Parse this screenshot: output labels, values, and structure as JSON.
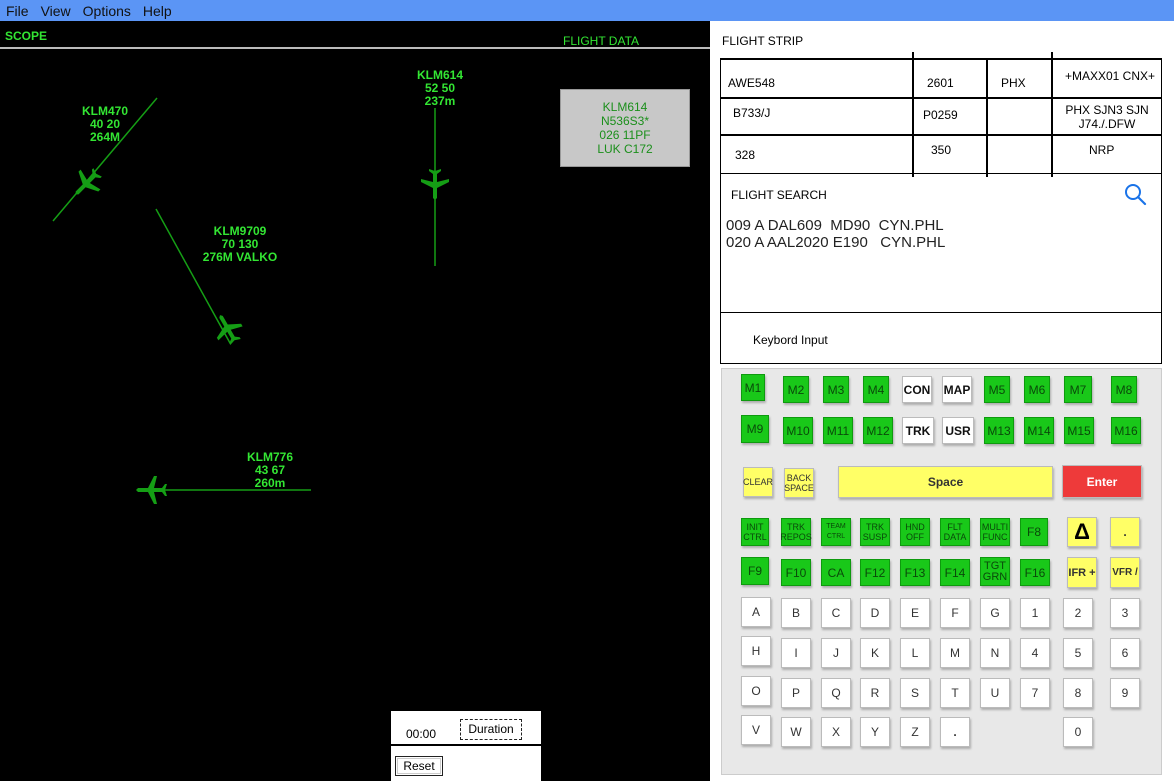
{
  "menu": [
    "File",
    "View",
    "Options",
    "Help"
  ],
  "scope": {
    "title": "SCOPE",
    "flight_data_title": "FLIGHT DATA",
    "flight_data_box": [
      "KLM614",
      "N536S3*",
      "026   11PF",
      "LUK C172"
    ],
    "tags": [
      {
        "lines": [
          "KLM614",
          "52  50",
          "237m"
        ]
      },
      {
        "lines": [
          "KLM470",
          "40   20",
          "264M"
        ]
      },
      {
        "lines": [
          "KLM9709",
          "70  130",
          "276M VALKO"
        ]
      },
      {
        "lines": [
          "KLM776",
          "43  67",
          "260m"
        ]
      }
    ],
    "timer": "00:00",
    "duration_label": "Duration",
    "reset_label": "Reset"
  },
  "strip": {
    "title": "FLIGHT STRIP",
    "cells": [
      [
        "AWE548",
        "2601",
        "PHX",
        "+MAXX01 CNX+"
      ],
      [
        "B733/J",
        "P0259",
        "",
        "PHX SJN3 SJN J74./.DFW"
      ],
      [
        "328",
        "350",
        "",
        "NRP"
      ]
    ]
  },
  "search": {
    "title": "FLIGHT SEARCH",
    "results": [
      "009 A DAL609  MD90  CYN.PHL",
      "020 A AAL2020 E190   CYN.PHL"
    ],
    "keyboard_label": "Keybord Input"
  },
  "colors": {
    "scope_green": "#33e633",
    "key_green": "#19c819",
    "key_yellow": "#ffff66",
    "key_red": "#ee3a3a",
    "menu_blue": "#5b95f5"
  },
  "keypad": {
    "row1": [
      "M1",
      "M2",
      "M3",
      "M4",
      "CON",
      "MAP",
      "M5",
      "M6",
      "M7",
      "M8"
    ],
    "row2": [
      "M9",
      "M10",
      "M11",
      "M12",
      "TRK",
      "USR",
      "M13",
      "M14",
      "M15",
      "M16"
    ],
    "clear": "CLEAR",
    "backspace": "BACK SPACE",
    "space": "Space",
    "enter": "Enter",
    "row4": [
      "INIT CTRL",
      "TRK REPOS",
      "TEAM CTRL",
      "TRK SUSP",
      "HND OFF",
      "FLT DATA",
      "MULTI FUNC",
      "F8"
    ],
    "triangle": "Δ",
    "dot": ".",
    "row5": [
      "F9",
      "F10",
      "CA",
      "F12",
      "F13",
      "F14",
      "TGT GRN",
      "F16"
    ],
    "ifr": "IFR +",
    "vfr": "VFR /",
    "letters": [
      [
        "A",
        "B",
        "C",
        "D",
        "E",
        "F",
        "G",
        "1",
        "2",
        "3"
      ],
      [
        "H",
        "I",
        "J",
        "K",
        "L",
        "M",
        "N",
        "4",
        "5",
        "6"
      ],
      [
        "O",
        "P",
        "Q",
        "R",
        "S",
        "T",
        "U",
        "7",
        "8",
        "9"
      ],
      [
        "V",
        "W",
        "X",
        "Y",
        "Z",
        "."
      ]
    ],
    "zero": "0"
  }
}
